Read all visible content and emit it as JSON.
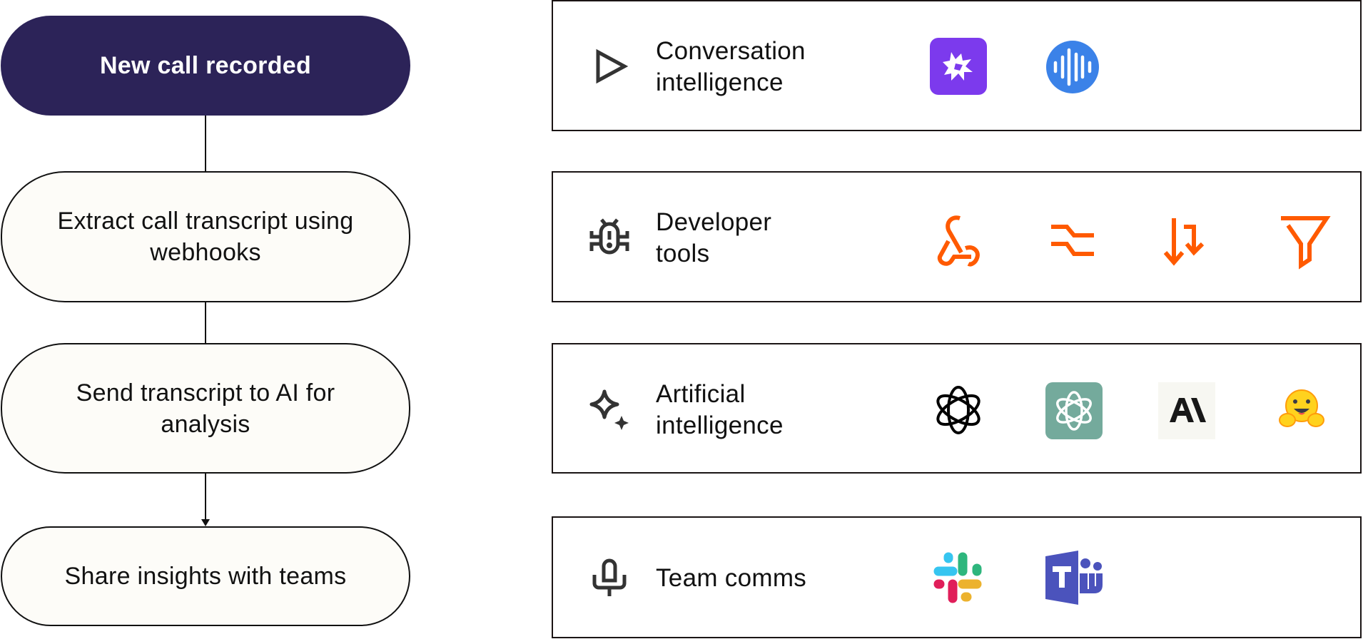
{
  "flow": {
    "steps": [
      {
        "label": "New call recorded",
        "kind": "trigger"
      },
      {
        "label": "Extract call transcript using webhooks",
        "kind": "action"
      },
      {
        "label": "Send transcript to AI  for analysis",
        "kind": "action"
      },
      {
        "label": "Share insights with teams",
        "kind": "action"
      }
    ],
    "colors": {
      "trigger_fill": "#2c2358",
      "step_fill": "#fdfcf8",
      "stroke": "#111111"
    }
  },
  "categories": [
    {
      "title_line1": "Conversation",
      "title_line2": "intelligence",
      "icon": "play-triangle-icon",
      "apps": [
        {
          "name": "gong-icon",
          "color": "#7c3aed"
        },
        {
          "name": "audio-waveform-icon",
          "color": "#3b82e8"
        }
      ]
    },
    {
      "title_line1": "Developer",
      "title_line2": "tools",
      "icon": "bug-icon",
      "apps": [
        {
          "name": "webhook-icon",
          "color": "#ff5a00"
        },
        {
          "name": "router-icon",
          "color": "#ff5a00"
        },
        {
          "name": "sort-arrows-icon",
          "color": "#ff5a00"
        },
        {
          "name": "filter-icon",
          "color": "#ff5a00"
        }
      ]
    },
    {
      "title_line1": "Artificial",
      "title_line2": "intelligence",
      "icon": "sparkle-icon",
      "apps": [
        {
          "name": "openai-icon",
          "color": "#000000"
        },
        {
          "name": "chatgpt-icon",
          "color": "#74aa9c"
        },
        {
          "name": "anthropic-icon",
          "color": "#181818"
        },
        {
          "name": "hugging-face-icon",
          "color": "#ffd21e"
        }
      ]
    },
    {
      "title_line1": "Team comms",
      "title_line2": "",
      "icon": "microphone-icon",
      "apps": [
        {
          "name": "slack-icon",
          "color": "#36c5f0"
        },
        {
          "name": "microsoft-teams-icon",
          "color": "#4b53bc"
        }
      ]
    }
  ],
  "logo_text": {
    "anthropic": "A\\",
    "teams": "T"
  }
}
